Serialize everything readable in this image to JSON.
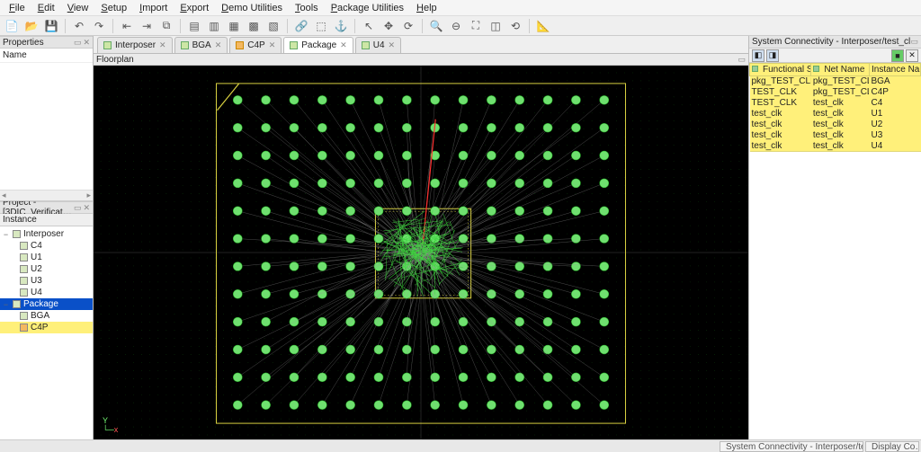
{
  "menubar": [
    "File",
    "Edit",
    "View",
    "Setup",
    "Import",
    "Export",
    "Demo Utilities",
    "Tools",
    "Package Utilities",
    "Help"
  ],
  "toolbar_icons": [
    "new-icon",
    "open-icon",
    "save-icon",
    "sep",
    "undo-icon",
    "redo-icon",
    "sep",
    "arrow-left-icon",
    "arrow-right-icon",
    "snapshot-icon",
    "sep",
    "align-left-icon",
    "align-center-icon",
    "align-right-icon",
    "distribute-icon",
    "stack-icon",
    "sep",
    "link-icon",
    "unlink-icon",
    "anchor-icon",
    "sep",
    "pointer-icon",
    "move-icon",
    "rotate-icon",
    "sep",
    "zoom-in-icon",
    "zoom-out-icon",
    "zoom-fit-icon",
    "zoom-sel-icon",
    "refresh-icon",
    "sep",
    "measure-icon"
  ],
  "toolbar_glyphs": {
    "new-icon": "📄",
    "open-icon": "📂",
    "save-icon": "💾",
    "undo-icon": "↶",
    "redo-icon": "↷",
    "arrow-left-icon": "⇤",
    "arrow-right-icon": "⇥",
    "snapshot-icon": "⧉",
    "align-left-icon": "▤",
    "align-center-icon": "▥",
    "align-right-icon": "▦",
    "distribute-icon": "▩",
    "stack-icon": "▧",
    "link-icon": "🔗",
    "unlink-icon": "⬚",
    "anchor-icon": "⚓",
    "pointer-icon": "↖",
    "move-icon": "✥",
    "rotate-icon": "⟳",
    "zoom-in-icon": "🔍",
    "zoom-out-icon": "⊖",
    "zoom-fit-icon": "⛶",
    "zoom-sel-icon": "◫",
    "refresh-icon": "⟲",
    "measure-icon": "📐"
  },
  "left": {
    "props_title": "Properties",
    "props_name": "Name",
    "project_title": "Project - [3DIC_Verificat…",
    "instance_label": "Instance",
    "tree": [
      {
        "lvl": 0,
        "exp": "−",
        "label": "Interposer",
        "icon": "green"
      },
      {
        "lvl": 1,
        "exp": "",
        "label": "C4",
        "icon": "green"
      },
      {
        "lvl": 1,
        "exp": "",
        "label": "U1",
        "icon": "green"
      },
      {
        "lvl": 1,
        "exp": "",
        "label": "U2",
        "icon": "green"
      },
      {
        "lvl": 1,
        "exp": "",
        "label": "U3",
        "icon": "green"
      },
      {
        "lvl": 1,
        "exp": "",
        "label": "U4",
        "icon": "green"
      },
      {
        "lvl": 0,
        "exp": "−",
        "label": "Package",
        "icon": "green",
        "sel": true
      },
      {
        "lvl": 1,
        "exp": "",
        "label": "BGA",
        "icon": "green"
      },
      {
        "lvl": 1,
        "exp": "",
        "label": "C4P",
        "icon": "orange",
        "hl": true
      }
    ]
  },
  "tabs": [
    {
      "label": "Interposer",
      "active": false,
      "icon": "green"
    },
    {
      "label": "BGA",
      "active": false,
      "icon": "green"
    },
    {
      "label": "C4P",
      "active": false,
      "icon": "orange"
    },
    {
      "label": "Package",
      "active": true,
      "icon": "green"
    },
    {
      "label": "U4",
      "active": false,
      "icon": "green"
    }
  ],
  "floorplan": {
    "title": "Floorplan"
  },
  "right": {
    "title": "System Connectivity - Interposer/test_clk",
    "cols": [
      "Functional Signal",
      "Net Name",
      "Instance Nam"
    ],
    "rows": [
      [
        "pkg_TEST_CLK",
        "pkg_TEST_CLK",
        "BGA"
      ],
      [
        "TEST_CLK",
        "pkg_TEST_CLK",
        "C4P"
      ],
      [
        "TEST_CLK",
        "test_clk",
        "C4"
      ],
      [
        "test_clk",
        "test_clk",
        "U1"
      ],
      [
        "test_clk",
        "test_clk",
        "U2"
      ],
      [
        "test_clk",
        "test_clk",
        "U3"
      ],
      [
        "test_clk",
        "test_clk",
        "U4"
      ]
    ]
  },
  "statusbar": {
    "btn1": "System Connectivity - Interposer/tes…",
    "btn2": "Display Co…"
  }
}
